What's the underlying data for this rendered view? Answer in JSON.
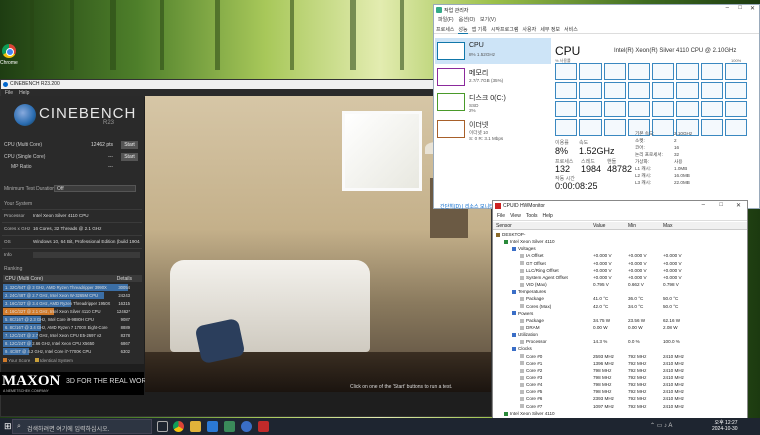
{
  "desktop": {
    "chrome_label": "Chrome"
  },
  "cinebench": {
    "title": "CINEBENCH R23.200",
    "menu": [
      "File",
      "Help"
    ],
    "logo": "CINEBENCH",
    "version": "R23",
    "tests": [
      {
        "label": "CPU (Multi Core)",
        "value": "12462 pts",
        "button": "Start"
      },
      {
        "label": "CPU (Single Core)",
        "value": "---",
        "button": "Start"
      },
      {
        "label": "MP Ratio",
        "value": "---",
        "button": ""
      }
    ],
    "min_duration_label": "Minimum Test Duration",
    "min_duration_value": "Off",
    "system_heading": "Your System",
    "system": [
      {
        "k": "Processor",
        "v": "Intel Xeon Silver 4110 CPU"
      },
      {
        "k": "Cores x GHz",
        "v": "16 Cores, 32 Threads @ 2.1 GHz"
      },
      {
        "k": "OS",
        "v": "Windows 10, 64 Bit, Professional Edition (build 19044)"
      },
      {
        "k": "Info",
        "v": ""
      }
    ],
    "ranking_heading": "Ranking",
    "ranking_select": "CPU (Multi Core)",
    "ranking_details": "Details",
    "ranking": [
      {
        "label": "1. 32C/64T @ 3 GHz, AMD Ryzen Threadripper 3990X",
        "score": "30054",
        "pct": 1.0,
        "color": "#3b6ea5"
      },
      {
        "label": "2. 24C/48T @ 2.7 GHz, Intel Xeon W-3265M CPU",
        "score": "24243",
        "pct": 0.81,
        "color": "#3b6ea5"
      },
      {
        "label": "3. 16C/32T @ 3.4 GHz, AMD Ryzen Threadripper 1950X",
        "score": "16315",
        "pct": 0.54,
        "color": "#3b6ea5"
      },
      {
        "label": "4. 16C/32T @ 2.1 GHz, Intel Xeon Silver 4110 CPU",
        "score": "12462*",
        "pct": 0.41,
        "color": "#d07a2a"
      },
      {
        "label": "5. 8C/16T @ 2.3 GHz, Intel Core i9-9880H CPU",
        "score": "9087",
        "pct": 0.3,
        "color": "#3b6ea5"
      },
      {
        "label": "6. 8C/16T @ 3.4 GHz, AMD Ryzen 7 1700X Eight-Core",
        "score": "8889",
        "pct": 0.3,
        "color": "#3b6ea5"
      },
      {
        "label": "7. 12C/24T @ 2.7 GHz, Intel Xeon CPU E5-2697 v2",
        "score": "8378",
        "pct": 0.28,
        "color": "#3b6ea5"
      },
      {
        "label": "8. 12C/24T @ 2.66 GHz, Intel Xeon CPU X5650",
        "score": "6867",
        "pct": 0.23,
        "color": "#3b6ea5"
      },
      {
        "label": "9. 4C/8T @ 4.2 GHz, Intel Core i7-7700K CPU",
        "score": "6302",
        "pct": 0.21,
        "color": "#3b6ea5"
      }
    ],
    "legend_your": "Your Score",
    "legend_identical": "Identical System",
    "brand": "MAXON",
    "brand_sub": "A NEMETSCHEK COMPANY",
    "tagline": "3D FOR THE REAL WORLD",
    "footer_hint": "Click on one of the 'Start' buttons to run a test."
  },
  "taskmgr": {
    "title": "작업 관리자",
    "menu": [
      "파일(F)",
      "옵션(O)",
      "보기(V)"
    ],
    "tabs": [
      "프로세스",
      "성능",
      "앱 기록",
      "시작프로그램",
      "사용자",
      "세부 정보",
      "서비스"
    ],
    "sidebar": [
      {
        "name": "CPU",
        "sub": "8% 1.52GHz",
        "color": "#1a7fc0"
      },
      {
        "name": "메모리",
        "sub": "2.7/7.7GB (35%)",
        "color": "#8b2a9c"
      },
      {
        "name": "디스크 0(C:)",
        "sub": "SSD\n2%",
        "color": "#4a9a2a"
      },
      {
        "name": "이더넷",
        "sub": "이더넷 10\nS: 0 R: 3.1 Mbps",
        "color": "#a8602a"
      }
    ],
    "heading": "CPU",
    "model": "Intel(R) Xeon(R) Silver 4110 CPU @ 2.10GHz",
    "util_label": "% 사용률",
    "util_max": "100%",
    "stats": {
      "usage_label": "이용률",
      "usage": "8%",
      "speed_label": "속도",
      "speed": "1.52GHz",
      "proc_label": "프로세스",
      "proc": "132",
      "threads_label": "스레드",
      "threads": "1984",
      "handles_label": "핸들",
      "handles": "48782",
      "uptime_label": "작동 시간",
      "uptime": "0:00:08:25"
    },
    "specs": [
      {
        "k": "기본 속도:",
        "v": "2.10GHz"
      },
      {
        "k": "소켓:",
        "v": "2"
      },
      {
        "k": "코어:",
        "v": "16"
      },
      {
        "k": "논리 프로세서:",
        "v": "32"
      },
      {
        "k": "가상화:",
        "v": "사용"
      },
      {
        "k": "L1 캐시:",
        "v": "1.0MB"
      },
      {
        "k": "L2 캐시:",
        "v": "16.0MB"
      },
      {
        "k": "L3 캐시:",
        "v": "22.0MB"
      }
    ],
    "footer": "간단히(D)  |  리소스 모니터 열기"
  },
  "hwmonitor": {
    "title": "CPUID HWMonitor",
    "menu": [
      "File",
      "View",
      "Tools",
      "Help"
    ],
    "cols": [
      "Sensor",
      "Value",
      "Min",
      "Max"
    ],
    "rows": [
      {
        "i": 0,
        "n": "DESKTOP-",
        "v": "",
        "mn": "",
        "mx": ""
      },
      {
        "i": 1,
        "n": "Intel Xeon Silver 4110",
        "v": "",
        "mn": "",
        "mx": ""
      },
      {
        "i": 2,
        "n": "Voltages",
        "v": "",
        "mn": "",
        "mx": ""
      },
      {
        "i": 3,
        "n": "IA Offset",
        "v": "+0.000 V",
        "mn": "+0.000 V",
        "mx": "+0.000 V"
      },
      {
        "i": 3,
        "n": "GT Offset",
        "v": "+0.000 V",
        "mn": "+0.000 V",
        "mx": "+0.000 V"
      },
      {
        "i": 3,
        "n": "LLC/Ring Offset",
        "v": "+0.000 V",
        "mn": "+0.000 V",
        "mx": "+0.000 V"
      },
      {
        "i": 3,
        "n": "System Agent Offset",
        "v": "+0.000 V",
        "mn": "+0.000 V",
        "mx": "+0.000 V"
      },
      {
        "i": 3,
        "n": "VID (Max)",
        "v": "0.795 V",
        "mn": "0.662 V",
        "mx": "0.798 V"
      },
      {
        "i": 2,
        "n": "Temperatures",
        "v": "",
        "mn": "",
        "mx": ""
      },
      {
        "i": 3,
        "n": "Package",
        "v": "41.0 °C",
        "mn": "36.0 °C",
        "mx": "50.0 °C"
      },
      {
        "i": 3,
        "n": "Cores (Max)",
        "v": "42.0 °C",
        "mn": "34.0 °C",
        "mx": "50.0 °C"
      },
      {
        "i": 2,
        "n": "Powers",
        "v": "",
        "mn": "",
        "mx": ""
      },
      {
        "i": 3,
        "n": "Package",
        "v": "34.75 W",
        "mn": "23.56 W",
        "mx": "62.16 W"
      },
      {
        "i": 3,
        "n": "DRAM",
        "v": "0.00 W",
        "mn": "0.00 W",
        "mx": "2.08 W"
      },
      {
        "i": 2,
        "n": "Utilization",
        "v": "",
        "mn": "",
        "mx": ""
      },
      {
        "i": 3,
        "n": "Processor",
        "v": "14.3 %",
        "mn": "0.0 %",
        "mx": "100.0 %"
      },
      {
        "i": 2,
        "n": "Clocks",
        "v": "",
        "mn": "",
        "mx": ""
      },
      {
        "i": 3,
        "n": "Core #0",
        "v": "2593 MHz",
        "mn": "792 MHz",
        "mx": "2410 MHz"
      },
      {
        "i": 3,
        "n": "Core #1",
        "v": "1396 MHz",
        "mn": "792 MHz",
        "mx": "2410 MHz"
      },
      {
        "i": 3,
        "n": "Core #2",
        "v": "798 MHz",
        "mn": "792 MHz",
        "mx": "2410 MHz"
      },
      {
        "i": 3,
        "n": "Core #3",
        "v": "798 MHz",
        "mn": "792 MHz",
        "mx": "2410 MHz"
      },
      {
        "i": 3,
        "n": "Core #4",
        "v": "798 MHz",
        "mn": "792 MHz",
        "mx": "2410 MHz"
      },
      {
        "i": 3,
        "n": "Core #5",
        "v": "798 MHz",
        "mn": "792 MHz",
        "mx": "2410 MHz"
      },
      {
        "i": 3,
        "n": "Core #6",
        "v": "2393 MHz",
        "mn": "792 MHz",
        "mx": "2410 MHz"
      },
      {
        "i": 3,
        "n": "Core #7",
        "v": "1097 MHz",
        "mn": "792 MHz",
        "mx": "2410 MHz"
      },
      {
        "i": 1,
        "n": "Intel Xeon Silver 4110",
        "v": "",
        "mn": "",
        "mx": ""
      }
    ]
  },
  "taskbar": {
    "search_placeholder": "검색하려면 여기에 입력하십시오.",
    "time": "오후 12:27",
    "date": "2024-10-30"
  }
}
